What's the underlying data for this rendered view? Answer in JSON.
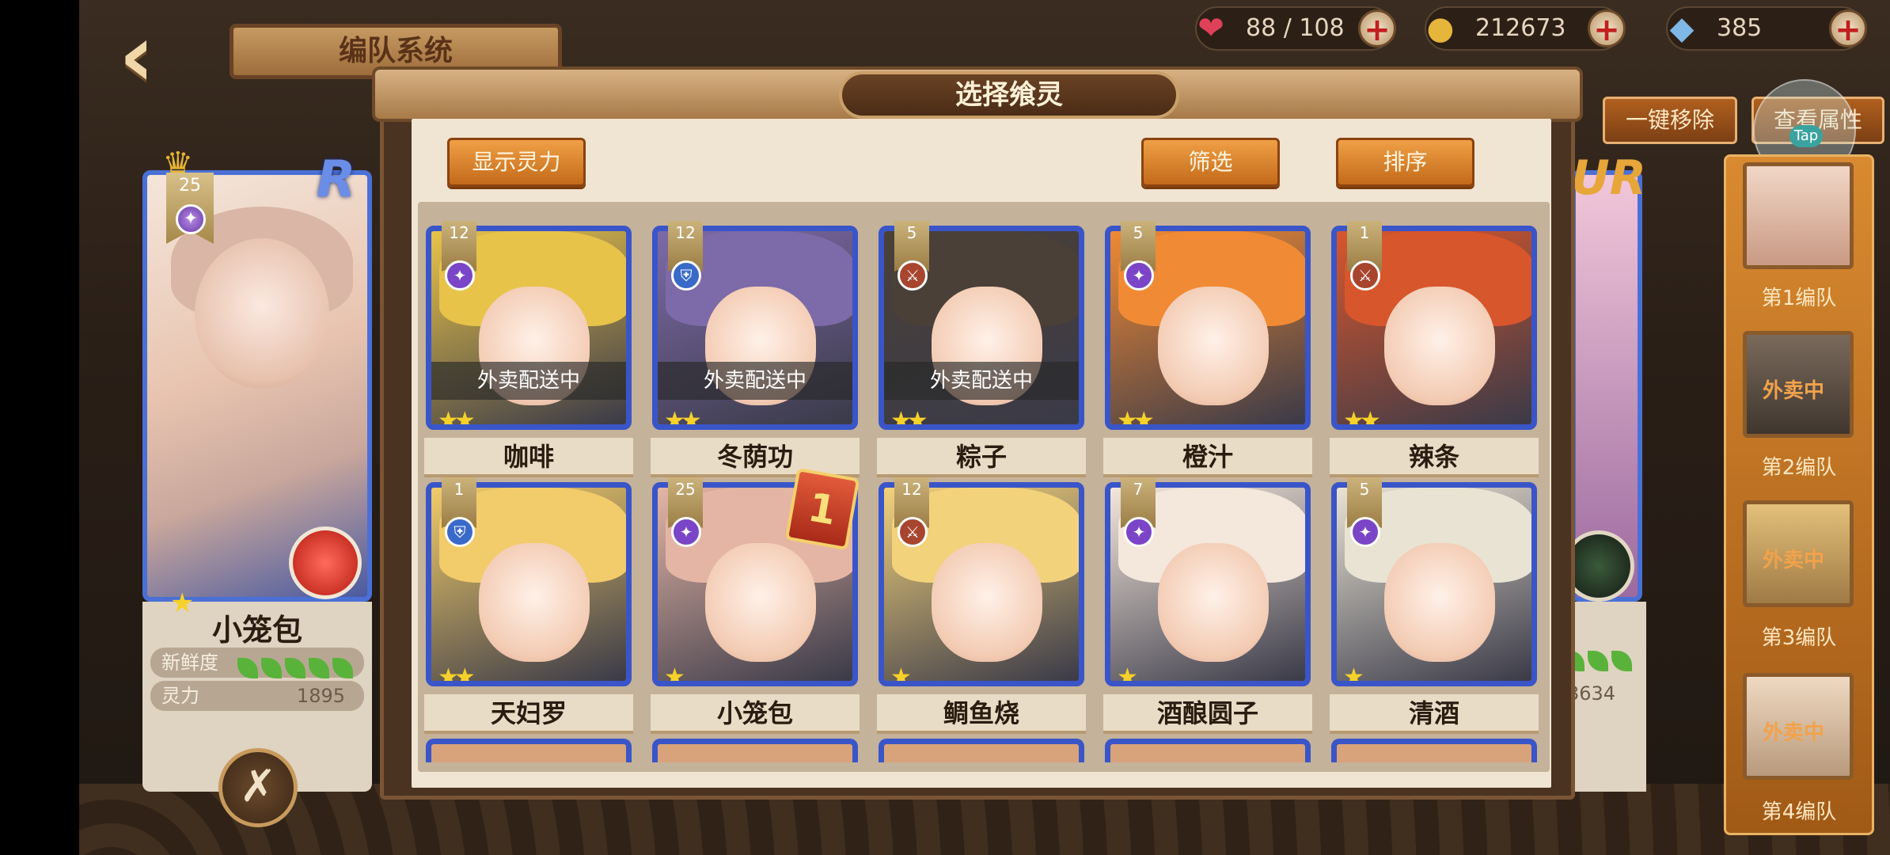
{
  "header": {
    "back_icon": "back-arrow-icon",
    "title": "编队系统"
  },
  "resources": [
    {
      "icon": "heart-icon",
      "value": "88 / 108"
    },
    {
      "icon": "coin-icon",
      "value": "212673"
    },
    {
      "icon": "crystal-icon",
      "value": "385"
    }
  ],
  "side_buttons": {
    "remove_all": "一键移除",
    "view_attr": "查看属性",
    "tap": "Tap"
  },
  "hero": {
    "rarity": "R",
    "level": "25",
    "name": "小笼包",
    "freshness_label": "新鲜度",
    "power_label": "灵力",
    "power_value": "1895"
  },
  "right_hero": {
    "rarity": "UR",
    "power_value": "3634"
  },
  "teams": [
    {
      "label": "第1编队"
    },
    {
      "label": "第2编队",
      "status": "外卖中"
    },
    {
      "label": "第3编队",
      "status": "外卖中"
    },
    {
      "label": "第4编队",
      "status": "外卖中"
    }
  ],
  "modal": {
    "title": "选择飨灵",
    "show_power": "显示灵力",
    "filter": "筛选",
    "sort": "排序"
  },
  "cards": [
    {
      "name": "咖啡",
      "level": "12",
      "element": "star",
      "stars": 2,
      "mission": "外卖配送中",
      "hair": "#e8c34a"
    },
    {
      "name": "冬荫功",
      "level": "12",
      "element": "shield",
      "stars": 2,
      "mission": "外卖配送中",
      "hair": "#7d6aa8"
    },
    {
      "name": "粽子",
      "level": "5",
      "element": "sword",
      "stars": 2,
      "mission": "外卖配送中",
      "hair": "#4a4038"
    },
    {
      "name": "橙汁",
      "level": "5",
      "element": "star",
      "stars": 2,
      "mission": "",
      "hair": "#f08a34"
    },
    {
      "name": "辣条",
      "level": "1",
      "element": "sword",
      "stars": 2,
      "mission": "",
      "hair": "#d8562c"
    },
    {
      "name": "天妇罗",
      "level": "1",
      "element": "shield",
      "stars": 2,
      "mission": "",
      "hair": "#f2cc6a"
    },
    {
      "name": "小笼包",
      "level": "25",
      "element": "star",
      "stars": 1,
      "mission": "",
      "hair": "#e4b5a5",
      "badge": "1"
    },
    {
      "name": "鲷鱼烧",
      "level": "12",
      "element": "sword",
      "stars": 1,
      "mission": "",
      "hair": "#f3d27c"
    },
    {
      "name": "酒酿圆子",
      "level": "7",
      "element": "star",
      "stars": 1,
      "mission": "",
      "hair": "#f4e7dc"
    },
    {
      "name": "清酒",
      "level": "5",
      "element": "star",
      "stars": 1,
      "mission": "",
      "hair": "#e9e3d4"
    }
  ],
  "colors": {
    "star": "#7b45c7",
    "shield": "#3a6ac8",
    "sword": "#a8452e"
  }
}
